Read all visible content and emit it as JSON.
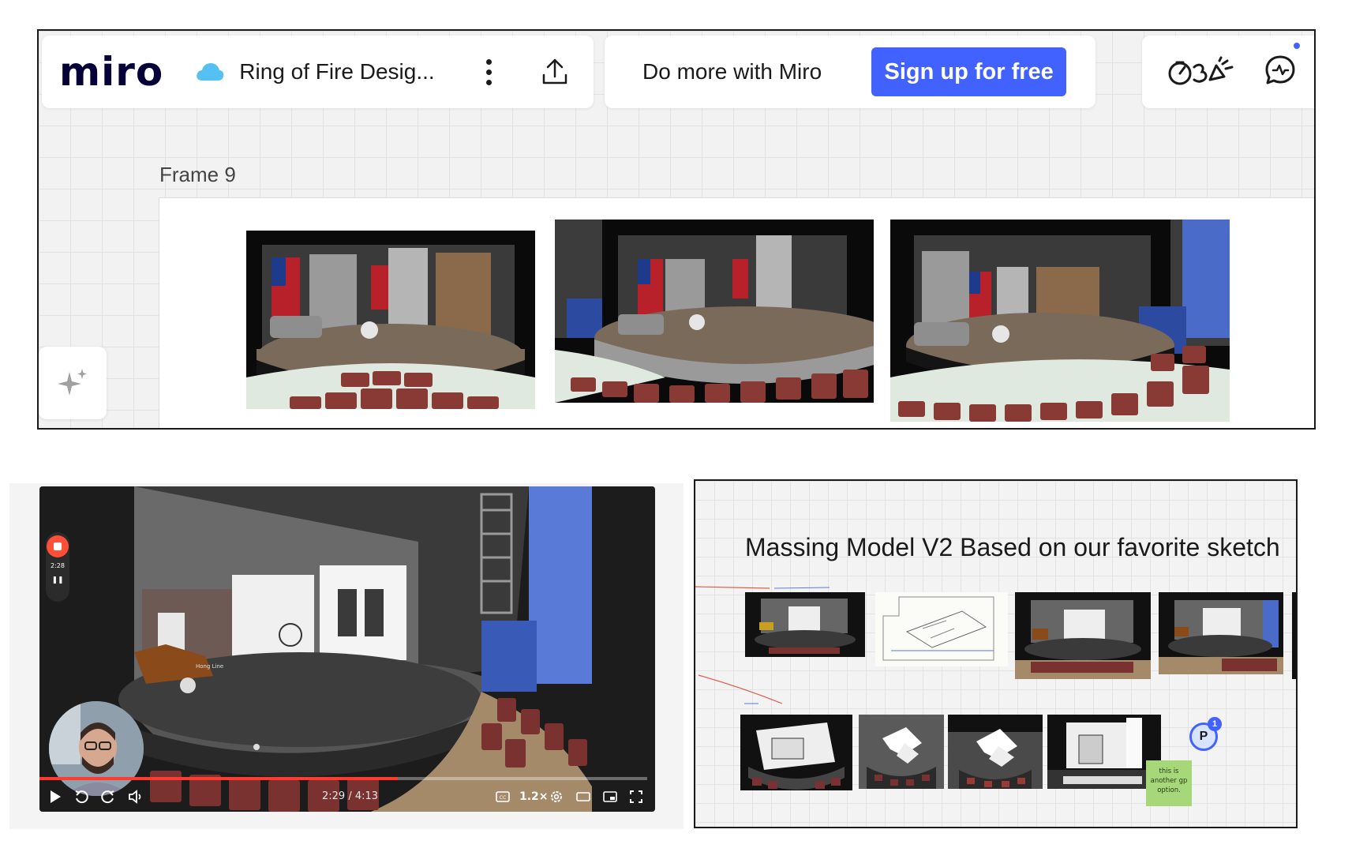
{
  "toolbar": {
    "logo": "miro",
    "board_name": "Ring of Fire Desig...",
    "promo_text": "Do more with Miro",
    "signup_label": "Sign up for free",
    "reactions_icon": "reactions-icon",
    "chat_icon": "chat-icon"
  },
  "board": {
    "frame_label": "Frame 9",
    "renders": [
      "stage-render-front",
      "stage-render-left",
      "stage-render-right"
    ]
  },
  "video": {
    "rec_time": "2:28",
    "time_display": "2:29 / 4:13",
    "speed": "1.2×",
    "progress_fraction": 0.59,
    "bar_value_label": "Hong Line"
  },
  "massing": {
    "title": "Massing Model V2 Based on our favorite sketch",
    "sticky_note": "this is another gp option.",
    "avatar_initial": "P",
    "avatar_badge": "1"
  },
  "colors": {
    "accent": "#4262ff",
    "record": "#ff4f38",
    "sticky": "#a6d87a",
    "seat_red": "#8a3a35"
  }
}
